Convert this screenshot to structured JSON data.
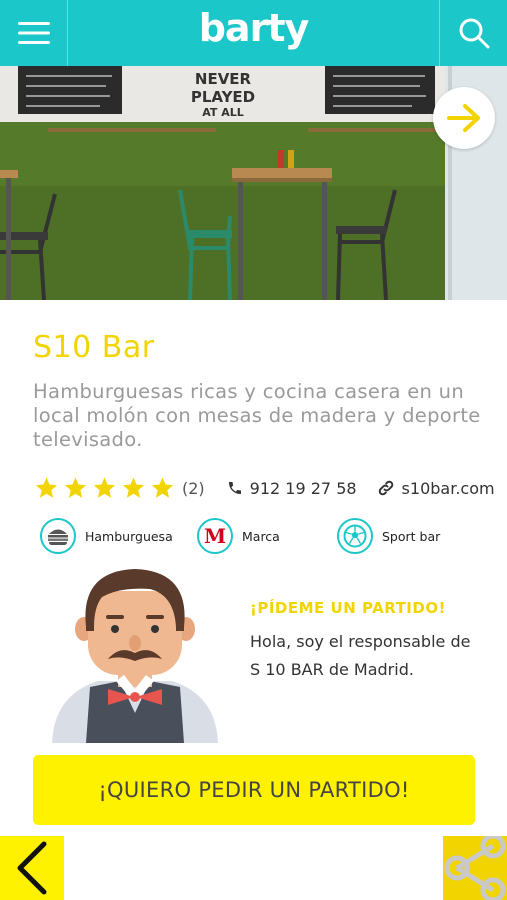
{
  "header": {
    "logo_text": "barty",
    "menu_icon": "hamburger-menu-icon",
    "search_icon": "search-icon",
    "color": "#1bc7c8"
  },
  "hero": {
    "wall_sign": "NEVER PLAYED AT ALL",
    "next_icon": "arrow-right-icon"
  },
  "bar": {
    "name": "S10 Bar",
    "description": "Hamburguesas ricas y cocina casera en un local molón con mesas de madera y deporte televisado.",
    "rating": 5,
    "rating_count": "(2)",
    "phone": "912 19 27 58",
    "website": "s10bar.com"
  },
  "tags": [
    {
      "label": "Hamburguesa",
      "icon": "burger-icon"
    },
    {
      "label": "Marca",
      "icon": "marca-logo-icon"
    },
    {
      "label": "Sport bar",
      "icon": "soccer-ball-icon"
    }
  ],
  "manager": {
    "cta_title": "¡PÍDEME UN PARTIDO!",
    "cta_text": "Hola, soy el responsable de S 10 BAR de Madrid."
  },
  "actions": {
    "request_match": "¡QUIERO PEDIR UN PARTIDO!",
    "back_icon": "chevron-left-icon",
    "share_icon": "share-icon"
  },
  "colors": {
    "accent_yellow": "#f2d400",
    "button_yellow": "#fff200",
    "teal": "#1bc7c8"
  }
}
